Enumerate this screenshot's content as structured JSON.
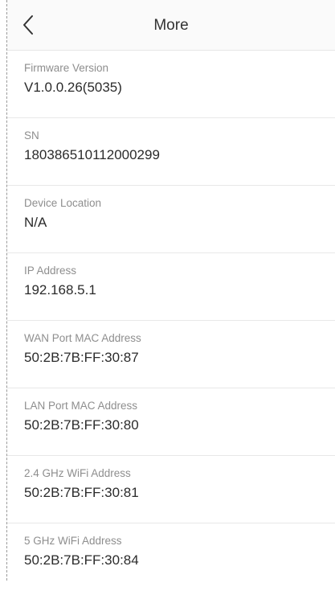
{
  "header": {
    "title": "More"
  },
  "items": [
    {
      "label": "Firmware Version",
      "value": "V1.0.0.26(5035)"
    },
    {
      "label": "SN",
      "value": "180386510112000299"
    },
    {
      "label": "Device Location",
      "value": "N/A"
    },
    {
      "label": "IP Address",
      "value": "192.168.5.1"
    },
    {
      "label": "WAN Port MAC Address",
      "value": "50:2B:7B:FF:30:87"
    },
    {
      "label": "LAN Port MAC Address",
      "value": "50:2B:7B:FF:30:80"
    },
    {
      "label": "2.4 GHz WiFi Address",
      "value": "50:2B:7B:FF:30:81"
    },
    {
      "label": "5 GHz WiFi Address",
      "value": "50:2B:7B:FF:30:84"
    }
  ],
  "colors": {
    "label": "#8e8e8e",
    "value": "#2b2b2b",
    "divider": "#e8e8e8",
    "header_bg": "#fafafa"
  }
}
